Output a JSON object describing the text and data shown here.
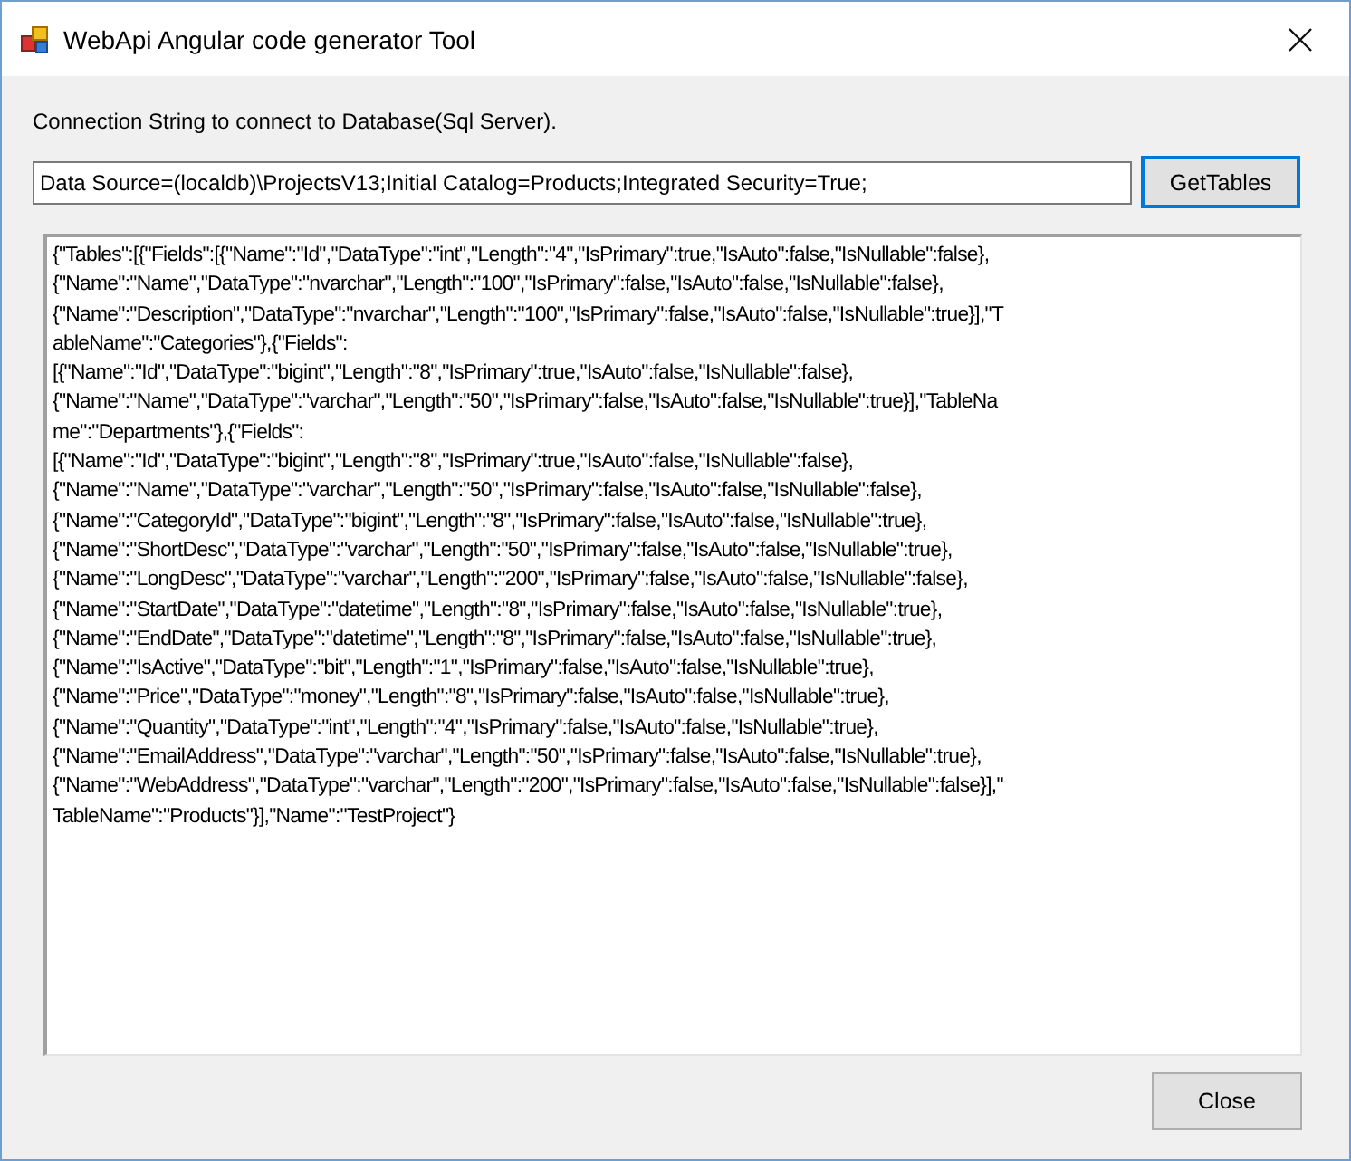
{
  "window": {
    "title": "WebApi Angular code generator Tool"
  },
  "connection": {
    "label": "Connection String to connect to Database(Sql Server).",
    "value": "Data Source=(localdb)\\ProjectsV13;Initial Catalog=Products;Integrated Security=True;"
  },
  "get_tables_button": "GetTables",
  "output_lines": [
    "{\"Tables\":[{\"Fields\":[{\"Name\":\"Id\",\"DataType\":\"int\",\"Length\":\"4\",\"IsPrimary\":true,\"IsAuto\":false,\"IsNullable\":false},",
    "{\"Name\":\"Name\",\"DataType\":\"nvarchar\",\"Length\":\"100\",\"IsPrimary\":false,\"IsAuto\":false,\"IsNullable\":false},",
    "{\"Name\":\"Description\",\"DataType\":\"nvarchar\",\"Length\":\"100\",\"IsPrimary\":false,\"IsAuto\":false,\"IsNullable\":true}],\"T",
    "ableName\":\"Categories\"},{\"Fields\":",
    "[{\"Name\":\"Id\",\"DataType\":\"bigint\",\"Length\":\"8\",\"IsPrimary\":true,\"IsAuto\":false,\"IsNullable\":false},",
    "{\"Name\":\"Name\",\"DataType\":\"varchar\",\"Length\":\"50\",\"IsPrimary\":false,\"IsAuto\":false,\"IsNullable\":true}],\"TableNa",
    "me\":\"Departments\"},{\"Fields\":",
    "[{\"Name\":\"Id\",\"DataType\":\"bigint\",\"Length\":\"8\",\"IsPrimary\":true,\"IsAuto\":false,\"IsNullable\":false},",
    "{\"Name\":\"Name\",\"DataType\":\"varchar\",\"Length\":\"50\",\"IsPrimary\":false,\"IsAuto\":false,\"IsNullable\":false},",
    "{\"Name\":\"CategoryId\",\"DataType\":\"bigint\",\"Length\":\"8\",\"IsPrimary\":false,\"IsAuto\":false,\"IsNullable\":true},",
    "{\"Name\":\"ShortDesc\",\"DataType\":\"varchar\",\"Length\":\"50\",\"IsPrimary\":false,\"IsAuto\":false,\"IsNullable\":true},",
    "{\"Name\":\"LongDesc\",\"DataType\":\"varchar\",\"Length\":\"200\",\"IsPrimary\":false,\"IsAuto\":false,\"IsNullable\":false},",
    "{\"Name\":\"StartDate\",\"DataType\":\"datetime\",\"Length\":\"8\",\"IsPrimary\":false,\"IsAuto\":false,\"IsNullable\":true},",
    "{\"Name\":\"EndDate\",\"DataType\":\"datetime\",\"Length\":\"8\",\"IsPrimary\":false,\"IsAuto\":false,\"IsNullable\":true},",
    "{\"Name\":\"IsActive\",\"DataType\":\"bit\",\"Length\":\"1\",\"IsPrimary\":false,\"IsAuto\":false,\"IsNullable\":true},",
    "{\"Name\":\"Price\",\"DataType\":\"money\",\"Length\":\"8\",\"IsPrimary\":false,\"IsAuto\":false,\"IsNullable\":true},",
    "{\"Name\":\"Quantity\",\"DataType\":\"int\",\"Length\":\"4\",\"IsPrimary\":false,\"IsAuto\":false,\"IsNullable\":true},",
    "{\"Name\":\"EmailAddress\",\"DataType\":\"varchar\",\"Length\":\"50\",\"IsPrimary\":false,\"IsAuto\":false,\"IsNullable\":true},",
    "{\"Name\":\"WebAddress\",\"DataType\":\"varchar\",\"Length\":\"200\",\"IsPrimary\":false,\"IsAuto\":false,\"IsNullable\":false}],\"",
    "TableName\":\"Products\"}],\"Name\":\"TestProject\"}"
  ],
  "close_button": "Close"
}
